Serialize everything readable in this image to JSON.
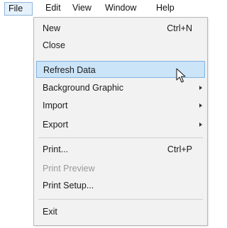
{
  "menubar": {
    "items": [
      {
        "label": "File"
      },
      {
        "label": "Edit"
      },
      {
        "label": "View"
      },
      {
        "label": "Window"
      },
      {
        "label": "Help"
      }
    ]
  },
  "file_menu": {
    "items": [
      {
        "label": "New",
        "shortcut": "Ctrl+N"
      },
      {
        "label": "Close"
      },
      {
        "label": "Refresh Data",
        "highlighted": true
      },
      {
        "label": "Background Graphic",
        "submenu": true
      },
      {
        "label": "Import",
        "submenu": true
      },
      {
        "label": "Export",
        "submenu": true
      },
      {
        "label": "Print...",
        "shortcut": "Ctrl+P"
      },
      {
        "label": "Print Preview",
        "disabled": true
      },
      {
        "label": "Print Setup..."
      },
      {
        "label": "Exit"
      }
    ]
  },
  "colors": {
    "highlight_bg": "#cce4f7",
    "highlight_border": "#7fb3e0",
    "menu_bg": "#f2f2f2",
    "disabled_text": "#9a9a9a"
  },
  "icons": {
    "cursor": "arrow-cursor-icon",
    "submenu_arrow": "submenu-arrow-icon"
  }
}
